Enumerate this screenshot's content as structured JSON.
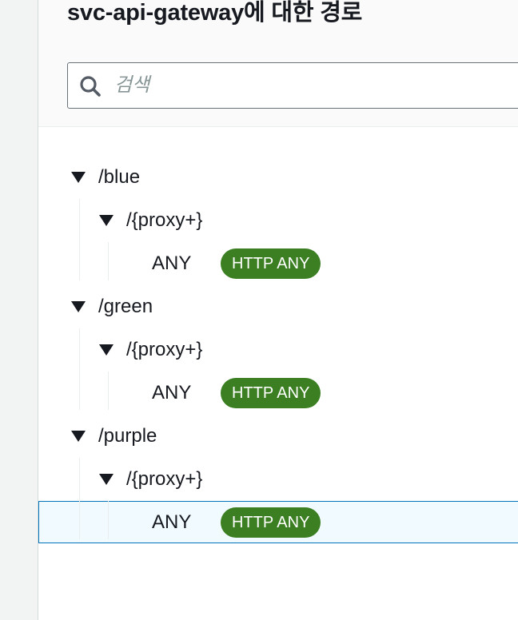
{
  "panel": {
    "title": "svc-api-gateway에 대한 경로"
  },
  "search": {
    "placeholder": "검색",
    "value": ""
  },
  "routes": [
    {
      "path": "/blue",
      "children": [
        {
          "path": "/{proxy+}",
          "method": "ANY",
          "badge": "HTTP ANY",
          "selected": false
        }
      ]
    },
    {
      "path": "/green",
      "children": [
        {
          "path": "/{proxy+}",
          "method": "ANY",
          "badge": "HTTP ANY",
          "selected": false
        }
      ]
    },
    {
      "path": "/purple",
      "children": [
        {
          "path": "/{proxy+}",
          "method": "ANY",
          "badge": "HTTP ANY",
          "selected": true
        }
      ]
    }
  ],
  "colors": {
    "badge_bg": "#3b7f22",
    "selected_border": "#0073bb",
    "selected_bg": "#f1faff"
  }
}
